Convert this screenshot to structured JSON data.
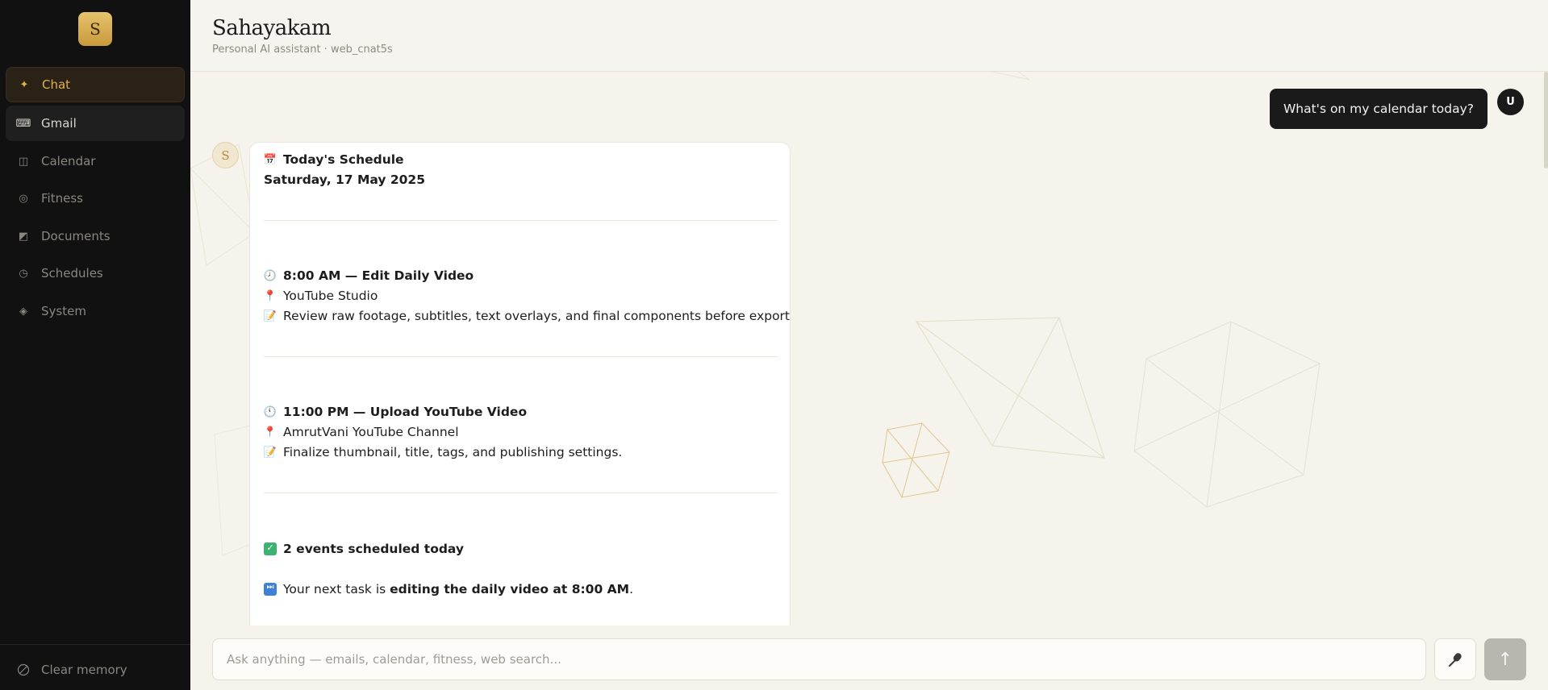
{
  "app": {
    "logo_letter": "S",
    "title": "Sahayakam",
    "subtitle": "Personal AI assistant · web_cnat5s"
  },
  "sidebar": {
    "items": [
      {
        "label": "Chat",
        "icon": "sparkle-icon",
        "glyph": "✦"
      },
      {
        "label": "Gmail",
        "icon": "keyboard-icon",
        "glyph": "⌨"
      },
      {
        "label": "Calendar",
        "icon": "book-icon",
        "glyph": "◫"
      },
      {
        "label": "Fitness",
        "icon": "target-icon",
        "glyph": "◎"
      },
      {
        "label": "Documents",
        "icon": "document-icon",
        "glyph": "◩"
      },
      {
        "label": "Schedules",
        "icon": "clock-icon",
        "glyph": "◷"
      },
      {
        "label": "System",
        "icon": "diamond-icon",
        "glyph": "◈"
      }
    ],
    "active": "Chat",
    "clear_memory": "Clear memory"
  },
  "chat": {
    "user_avatar": "U",
    "bot_avatar": "S",
    "user_message": "What's on my calendar today?",
    "bot": {
      "heading": "Today's Schedule",
      "date": "Saturday, 17 May 2025",
      "events": [
        {
          "time_title": "8:00 AM — Edit Daily Video",
          "location": "YouTube Studio",
          "note": "Review raw footage, subtitles, text overlays, and final components before export."
        },
        {
          "time_title": "11:00 PM — Upload YouTube Video",
          "location": "AmrutVani YouTube Channel",
          "note": "Finalize thumbnail, title, tags, and publishing settings."
        }
      ],
      "summary": "2 events scheduled today",
      "next_prefix": "Your next task is ",
      "next_bold": "editing the daily video at 8:00 AM",
      "next_suffix": "."
    }
  },
  "composer": {
    "placeholder": "Ask anything — emails, calendar, fitness, web search...",
    "send_glyph": "↑"
  },
  "colors": {
    "accent": "#e0b04f",
    "sidebar_bg": "#111111",
    "page_bg": "#f6f3ed"
  }
}
